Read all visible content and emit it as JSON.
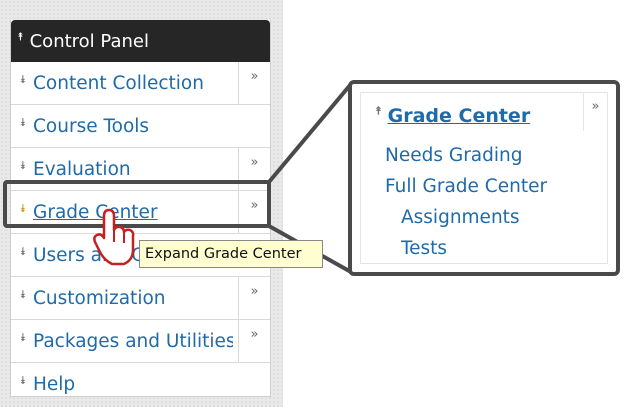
{
  "control_panel": {
    "title": "Control Panel",
    "items": [
      {
        "label": "Content Collection",
        "has_more": true
      },
      {
        "label": "Course Tools",
        "has_more": false
      },
      {
        "label": "Evaluation",
        "has_more": true
      },
      {
        "label": "Grade Center",
        "has_more": true,
        "active": true
      },
      {
        "label": "Users and Groups",
        "has_more": false
      },
      {
        "label": "Customization",
        "has_more": true
      },
      {
        "label": "Packages and Utilities",
        "has_more": true
      },
      {
        "label": "Help",
        "has_more": false
      }
    ]
  },
  "tooltip": {
    "text": "Expand Grade Center"
  },
  "callout": {
    "title": "Grade Center",
    "links": [
      "Needs Grading",
      "Full Grade Center",
      "Assignments",
      "Tests"
    ]
  },
  "colors": {
    "link": "#1f6aa9",
    "header_bg": "#262626",
    "tooltip_bg": "#fefed0",
    "active_chevron": "#d09a16"
  }
}
